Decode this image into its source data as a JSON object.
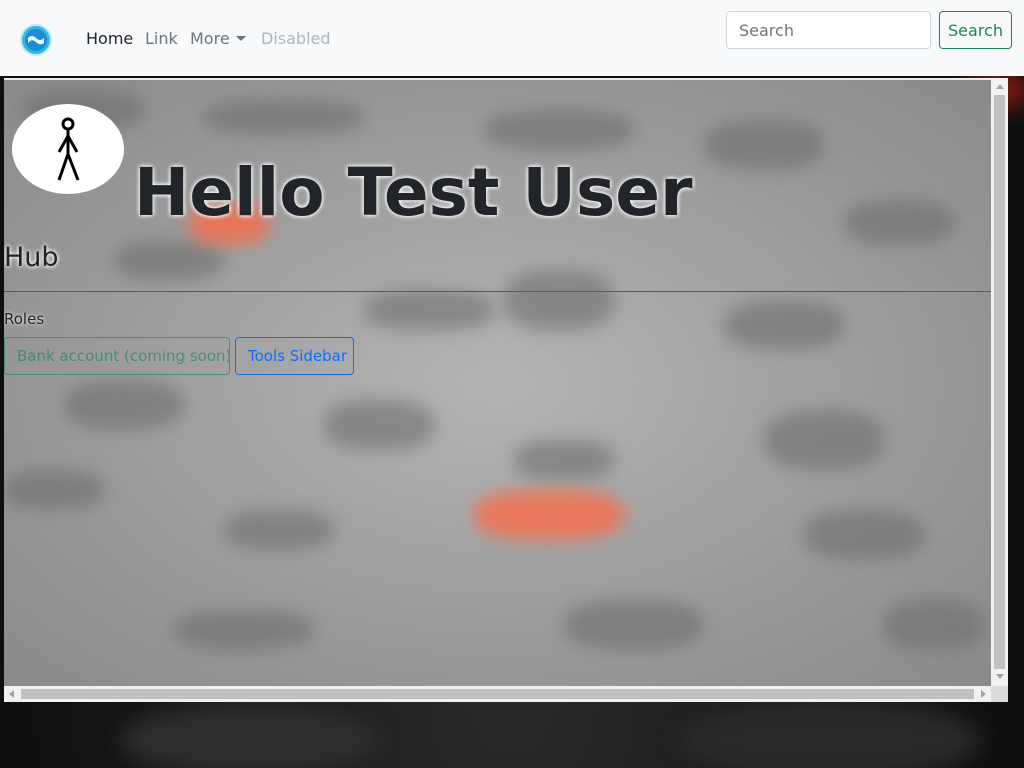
{
  "navbar": {
    "brand_icon": "globe-logo-icon",
    "links": [
      {
        "label": "Home",
        "state": "active"
      },
      {
        "label": "Link",
        "state": "normal"
      },
      {
        "label": "More",
        "state": "dropdown"
      },
      {
        "label": "Disabled",
        "state": "disabled"
      }
    ],
    "search": {
      "placeholder": "Search",
      "value": "",
      "button_label": "Search"
    }
  },
  "hub": {
    "greeting": "Hello Test User",
    "avatar_icon": "stick-figure-avatar-icon",
    "section_title": "Hub",
    "roles_label": "Roles",
    "buttons": [
      {
        "label": "Bank account (coming soon)",
        "state": "disabled"
      },
      {
        "label": "Tools Sidebar",
        "state": "enabled"
      }
    ]
  },
  "colors": {
    "navbar_bg": "#f8f9fa",
    "success": "#198754",
    "primary": "#0d6efd",
    "text_dark": "#212529",
    "text_muted": "#6c757d",
    "text_disabled": "#adb5bd"
  }
}
